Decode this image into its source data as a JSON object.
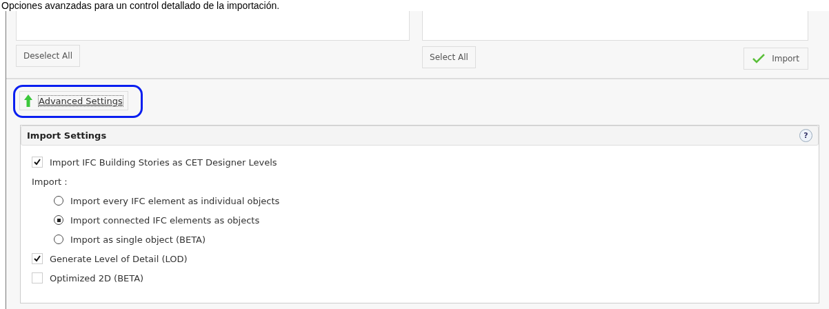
{
  "caption": "Opciones avanzadas para un control detallado de la importación.",
  "lists": [
    {
      "button": "Deselect All"
    },
    {
      "button": "Select All"
    }
  ],
  "import_button": "Import",
  "advanced_button": {
    "label": "Advanced Settings",
    "expanded": true,
    "highlighted": true
  },
  "group": {
    "title": "Import Settings",
    "help": "?",
    "items": [
      {
        "kind": "checkbox",
        "label": "Import IFC Building Stories as CET Designer Levels",
        "checked": true
      },
      {
        "kind": "label",
        "label": "Import :"
      },
      {
        "kind": "radio",
        "label": "Import every IFC element as individual objects",
        "selected": false
      },
      {
        "kind": "radio",
        "label": "Import connected IFC elements as objects",
        "selected": true
      },
      {
        "kind": "radio",
        "label": "Import as single object (BETA)",
        "selected": false
      },
      {
        "kind": "checkbox",
        "label": "Generate Level of Detail (LOD)",
        "checked": true
      },
      {
        "kind": "checkbox",
        "label": "Optimized 2D (BETA)",
        "checked": false
      }
    ]
  }
}
